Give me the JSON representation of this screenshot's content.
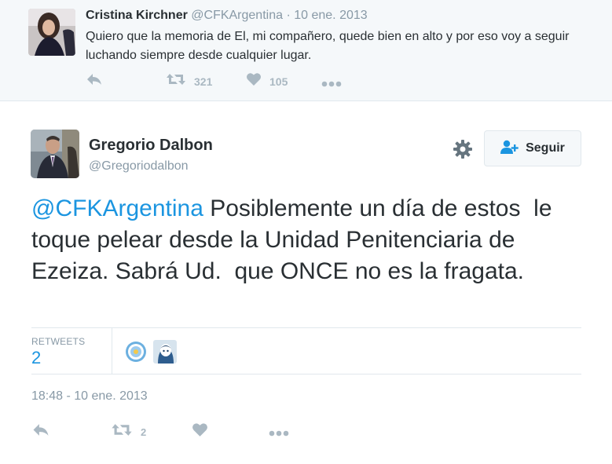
{
  "parent_tweet": {
    "name": "Cristina Kirchner",
    "handle": "@CFKArgentina",
    "separator": "·",
    "date": "10 ene. 2013",
    "text": "Quiero que la memoria de El, mi compañero, quede bien en alto y por eso voy a seguir luchando siempre desde cualquier lugar.",
    "retweet_count": "321",
    "like_count": "105"
  },
  "main_tweet": {
    "name": "Gregorio Dalbon",
    "handle": "@Gregoriodalbon",
    "follow_label": "Seguir",
    "mention": "@CFKArgentina",
    "text": " Posiblemente un día de estos  le toque pelear desde la Unidad Penitenciaria de Ezeiza. Sabrá Ud.  que ONCE no es la fragata.",
    "retweets_label": "RETWEETS",
    "retweets_value": "2",
    "timestamp": "18:48 - 10 ene. 2013",
    "retweet_action_count": "2"
  },
  "icons": [
    "reply-icon",
    "retweet-icon",
    "heart-icon",
    "more-icon",
    "gear-icon",
    "follow-person-icon"
  ],
  "colors": {
    "link": "#1b95e0",
    "muted": "#8899a6",
    "action": "#aab8c2",
    "parent_bg": "#f5f8fa",
    "border": "#e1e8ed"
  }
}
